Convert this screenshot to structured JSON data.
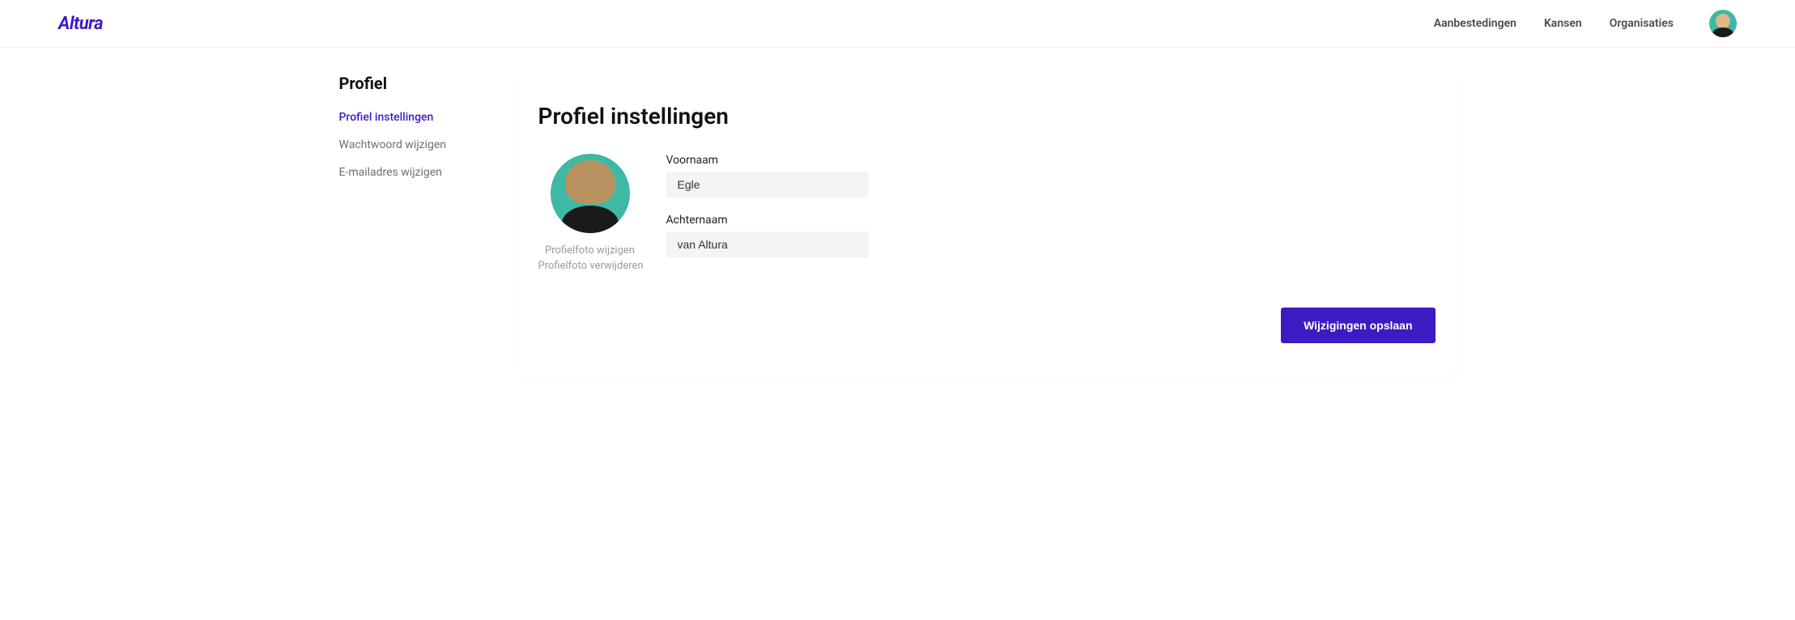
{
  "brand": "Altura",
  "nav": {
    "items": [
      {
        "label": "Aanbestedingen"
      },
      {
        "label": "Kansen"
      },
      {
        "label": "Organisaties"
      }
    ]
  },
  "sidebar": {
    "title": "Profiel",
    "items": [
      {
        "label": "Profiel instellingen",
        "active": true
      },
      {
        "label": "Wachtwoord wijzigen",
        "active": false
      },
      {
        "label": "E-mailadres wijzigen",
        "active": false
      }
    ]
  },
  "main": {
    "title": "Profiel instellingen",
    "photo": {
      "change_label": "Profielfoto wijzigen",
      "delete_label": "Profielfoto verwijderen"
    },
    "fields": {
      "firstname_label": "Voornaam",
      "firstname_value": "Egle",
      "lastname_label": "Achternaam",
      "lastname_value": "van Altura"
    },
    "save_label": "Wijzigingen opslaan"
  }
}
